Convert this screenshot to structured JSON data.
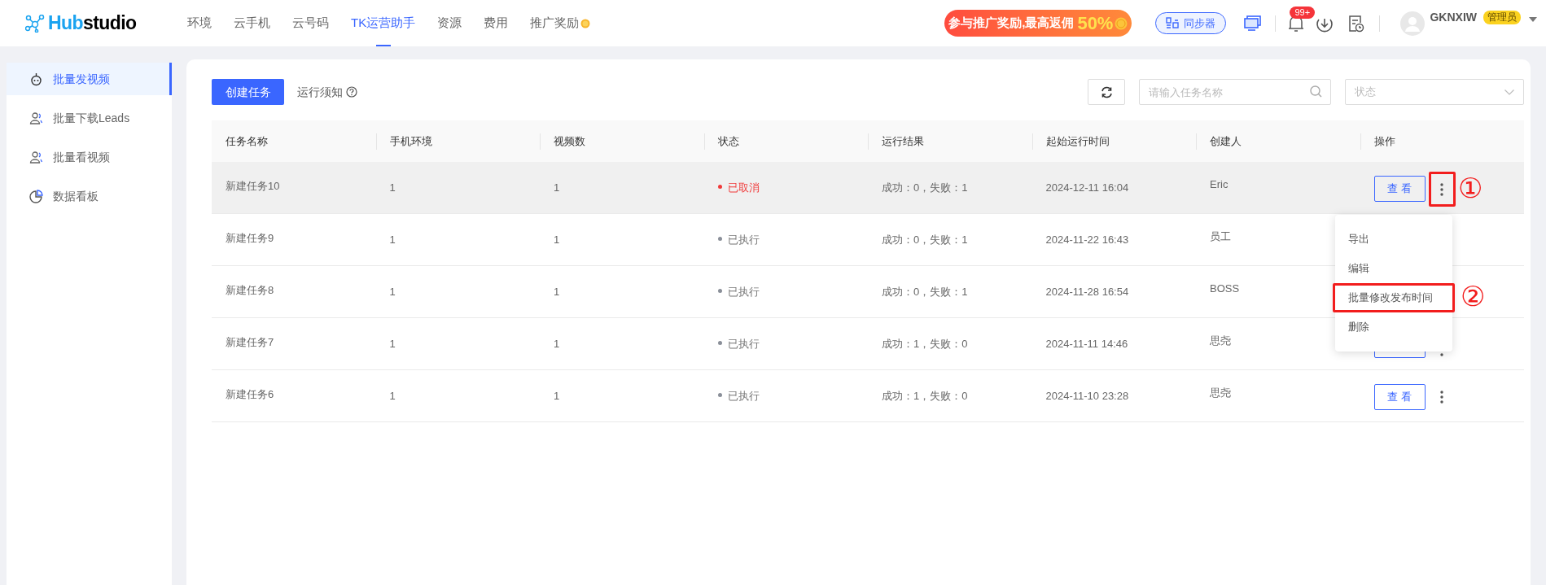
{
  "header": {
    "logo_accent": "Hub",
    "logo_rest": "studio",
    "nav": [
      {
        "label": "环境",
        "selected": false
      },
      {
        "label": "云手机",
        "selected": false
      },
      {
        "label": "云号码",
        "selected": false
      },
      {
        "label": "TK运营助手",
        "selected": true
      },
      {
        "label": "资源",
        "selected": false
      },
      {
        "label": "费用",
        "selected": false
      },
      {
        "label": "推广奖励",
        "selected": false,
        "kind": "coin"
      }
    ],
    "promo": {
      "text": "参与推广奖励,最高返佣",
      "highlight": "50%"
    },
    "sync_button": "同步器",
    "notification_badge": "99+",
    "user": {
      "name": "GKNXIW",
      "role": "管理员"
    }
  },
  "sidebar": {
    "items": [
      {
        "label": "批量发视频",
        "selected": true,
        "kind": "robot"
      },
      {
        "label": "批量下载Leads",
        "selected": false,
        "kind": "users"
      },
      {
        "label": "批量看视频",
        "selected": false,
        "kind": "users"
      },
      {
        "label": "数据看板",
        "selected": false,
        "kind": "chart"
      }
    ]
  },
  "toolbar": {
    "create_button": "创建任务",
    "notice_link": "运行须知",
    "search": {
      "placeholder": "请输入任务名称"
    },
    "status_select": {
      "placeholder": "状态"
    }
  },
  "table": {
    "columns": [
      "任务名称",
      "手机环境",
      "视频数",
      "状态",
      "运行结果",
      "起始运行时间",
      "创建人",
      "操作"
    ],
    "rows": [
      {
        "name": "新建任务10",
        "phone_env": "1",
        "video_count": "1",
        "status": {
          "label": "已取消",
          "kind": "cancelled"
        },
        "result": "成功：0，失败：1",
        "start_time": "2024-12-11 16:04",
        "creator": "Eric",
        "highlighted": true,
        "action": {
          "label": "查 看",
          "annotated": true
        }
      },
      {
        "name": "新建任务9",
        "phone_env": "1",
        "video_count": "1",
        "status": {
          "label": "已执行",
          "kind": "done"
        },
        "result": "成功：0，失败：1",
        "start_time": "2024-11-22 16:43",
        "creator": "员工",
        "highlighted": false
      },
      {
        "name": "新建任务8",
        "phone_env": "1",
        "video_count": "1",
        "status": {
          "label": "已执行",
          "kind": "done"
        },
        "result": "成功：0，失败：1",
        "start_time": "2024-11-28 16:54",
        "creator": "BOSS",
        "highlighted": false
      },
      {
        "name": "新建任务7",
        "phone_env": "1",
        "video_count": "1",
        "status": {
          "label": "已执行",
          "kind": "done"
        },
        "result": "成功：1，失败：0",
        "start_time": "2024-11-11 14:46",
        "creator": "思尧",
        "highlighted": false,
        "action": {
          "covered": true
        }
      },
      {
        "name": "新建任务6",
        "phone_env": "1",
        "video_count": "1",
        "status": {
          "label": "已执行",
          "kind": "done"
        },
        "result": "成功：1，失败：0",
        "start_time": "2024-11-10 23:28",
        "creator": "思尧",
        "highlighted": false,
        "action": {
          "label": "查 看",
          "annotated": false
        }
      }
    ]
  },
  "action_menu": {
    "items": [
      {
        "label": "导出",
        "annotated": false
      },
      {
        "label": "编辑",
        "annotated": false
      },
      {
        "label": "批量修改发布时间",
        "annotated": true
      },
      {
        "label": "删除",
        "annotated": false
      }
    ]
  },
  "annotations": [
    {
      "label": "①",
      "kind": "row"
    },
    {
      "label": "②",
      "kind": "menu"
    }
  ]
}
